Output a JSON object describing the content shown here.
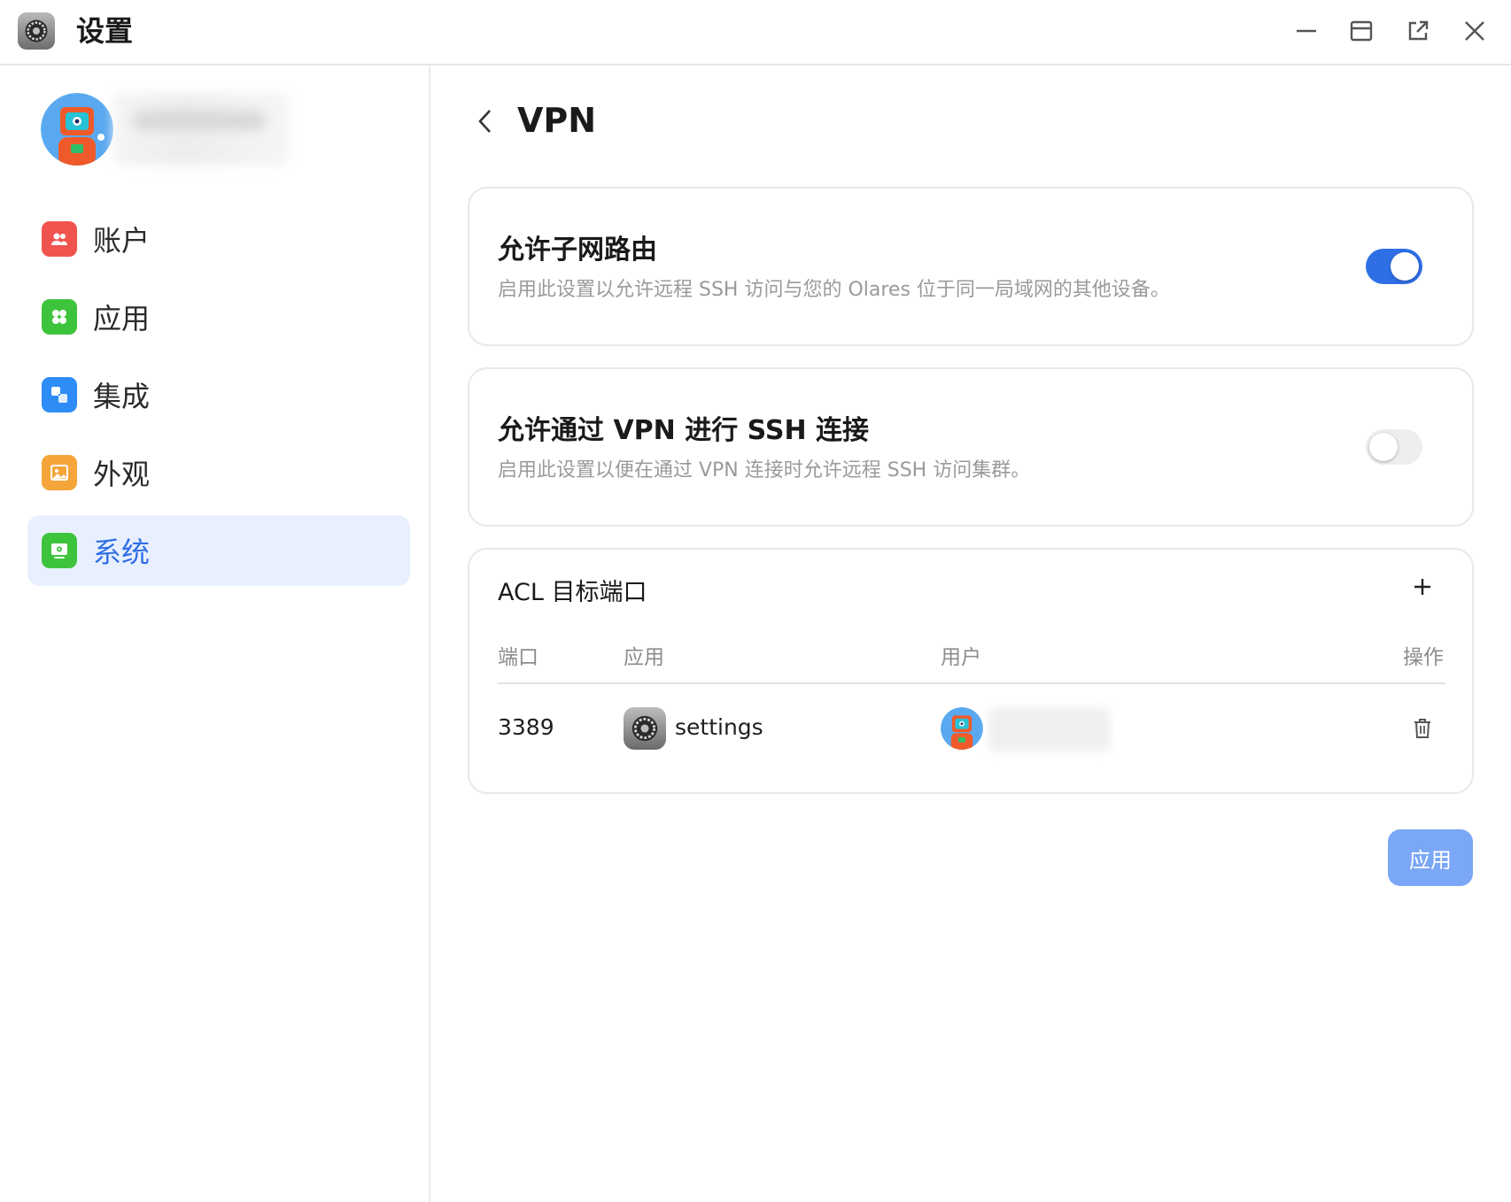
{
  "window": {
    "title": "设置",
    "controls": [
      "minimize-icon",
      "maximize-icon",
      "open-external-icon",
      "close-icon"
    ]
  },
  "sidebar": {
    "items": [
      {
        "label": "账户",
        "icon": "account-icon",
        "color": "#f0544f",
        "active": false
      },
      {
        "label": "应用",
        "icon": "apps-icon",
        "color": "#3ec43c",
        "active": false
      },
      {
        "label": "集成",
        "icon": "integration-icon",
        "color": "#2e8cf6",
        "active": false
      },
      {
        "label": "外观",
        "icon": "appearance-icon",
        "color": "#f5a53a",
        "active": false
      },
      {
        "label": "系统",
        "icon": "system-icon",
        "color": "#3ec43c",
        "active": true
      }
    ]
  },
  "main": {
    "title": "VPN",
    "subnet_routing": {
      "title": "允许子网路由",
      "description": "启用此设置以允许远程 SSH 访问与您的 Olares 位于同一局域网的其他设备。",
      "enabled": true
    },
    "ssh_over_vpn": {
      "title": "允许通过 VPN 进行 SSH 连接",
      "description": "启用此设置以便在通过 VPN 连接时允许远程 SSH 访问集群。",
      "enabled": false
    },
    "acl": {
      "title": "ACL 目标端口",
      "columns": {
        "port": "端口",
        "app": "应用",
        "user": "用户",
        "action": "操作"
      },
      "rows": [
        {
          "port": "3389",
          "app": "settings"
        }
      ]
    },
    "apply_label": "应用"
  },
  "colors": {
    "accent": "#2f6fe6",
    "apply_button": "#7aa7f6",
    "active_nav_bg": "#e8f0ff"
  }
}
